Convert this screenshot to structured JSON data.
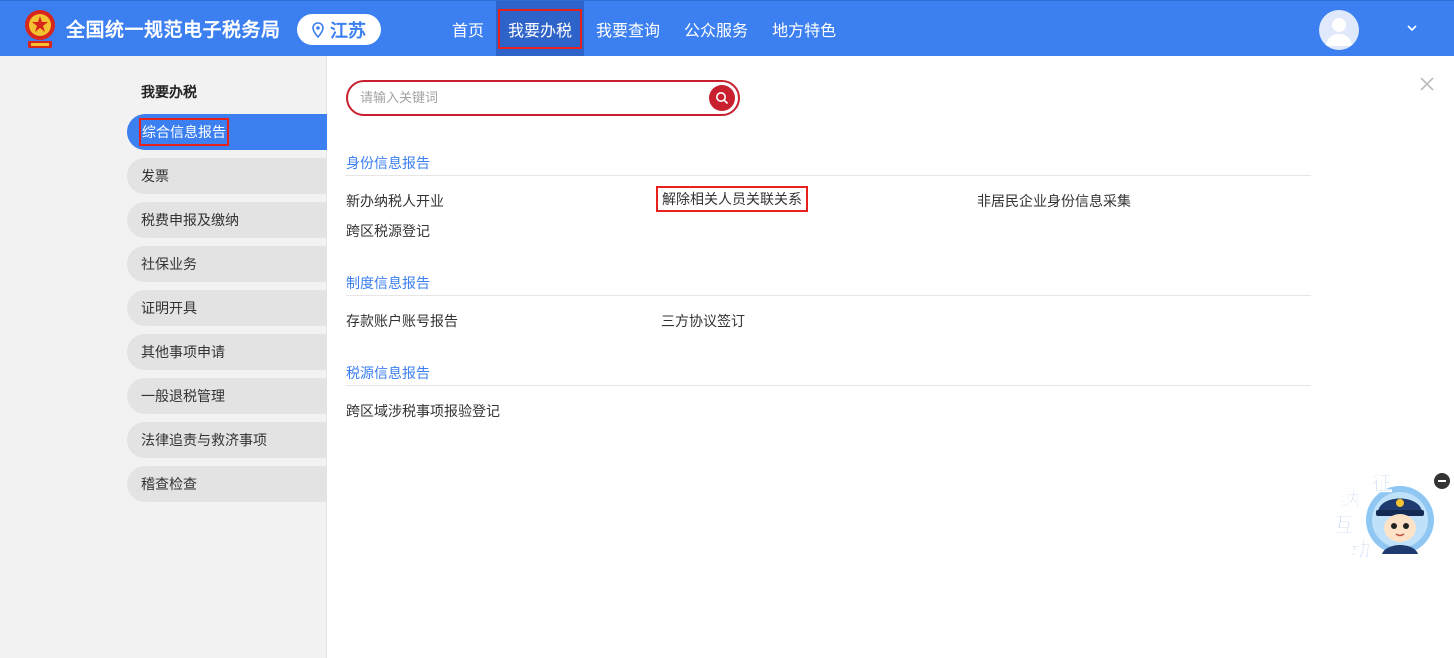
{
  "header": {
    "site_title": "全国统一规范电子税务局",
    "region": "江苏",
    "nav": [
      {
        "label": "首页"
      },
      {
        "label": "我要办税"
      },
      {
        "label": "我要查询"
      },
      {
        "label": "公众服务"
      },
      {
        "label": "地方特色"
      }
    ]
  },
  "sidebar": {
    "heading": "我要办税",
    "items": [
      {
        "label": "综合信息报告"
      },
      {
        "label": "发票"
      },
      {
        "label": "税费申报及缴纳"
      },
      {
        "label": "社保业务"
      },
      {
        "label": "证明开具"
      },
      {
        "label": "其他事项申请"
      },
      {
        "label": "一般退税管理"
      },
      {
        "label": "法律追责与救济事项"
      },
      {
        "label": "稽查检查"
      }
    ]
  },
  "search": {
    "placeholder": "请输入关键词"
  },
  "sections": [
    {
      "title": "身份信息报告",
      "links": [
        "新办纳税人开业",
        "解除相关人员关联关系",
        "非居民企业身份信息采集",
        "跨区税源登记"
      ]
    },
    {
      "title": "制度信息报告",
      "links": [
        "存款账户账号报告",
        "三方协议签订"
      ]
    },
    {
      "title": "税源信息报告",
      "links": [
        "跨区域涉税事项报验登记"
      ]
    }
  ],
  "widget": {
    "chars": [
      "征",
      "纳",
      "互",
      "动"
    ]
  },
  "colors": {
    "primary": "#3b7ff0",
    "highlight": "#e8211a",
    "search_accent": "#c8202f"
  }
}
